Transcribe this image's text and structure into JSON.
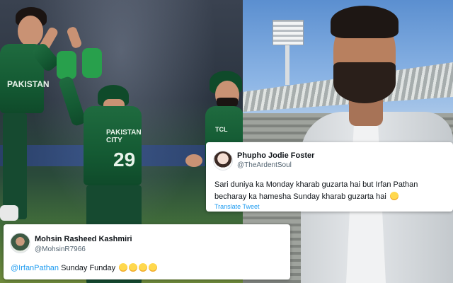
{
  "left_photo": {
    "jersey_text_front": "PAKISTAN",
    "jersey_text_back_team": "PAKISTAN CITY",
    "jersey_number": "29",
    "sponsor": "TCL"
  },
  "tweets": [
    {
      "name": "Phupho Jodie Foster",
      "handle": "@TheArdentSoul",
      "text": "Sari duniya ka Monday kharab guzarta hai but Irfan Pathan becharay ka hamesha Sunday kharab guzarta hai",
      "emoji_count": 1,
      "translate_label": "Translate Tweet"
    },
    {
      "name": "Mohsin Rasheed Kashmiri",
      "handle": "@MohsinR7966",
      "mention": "@IrfanPathan",
      "text": " Sunday Funday",
      "emoji_count": 4
    }
  ],
  "colors": {
    "link": "#1d9bf0",
    "jersey_green": "#1f6b3f"
  }
}
